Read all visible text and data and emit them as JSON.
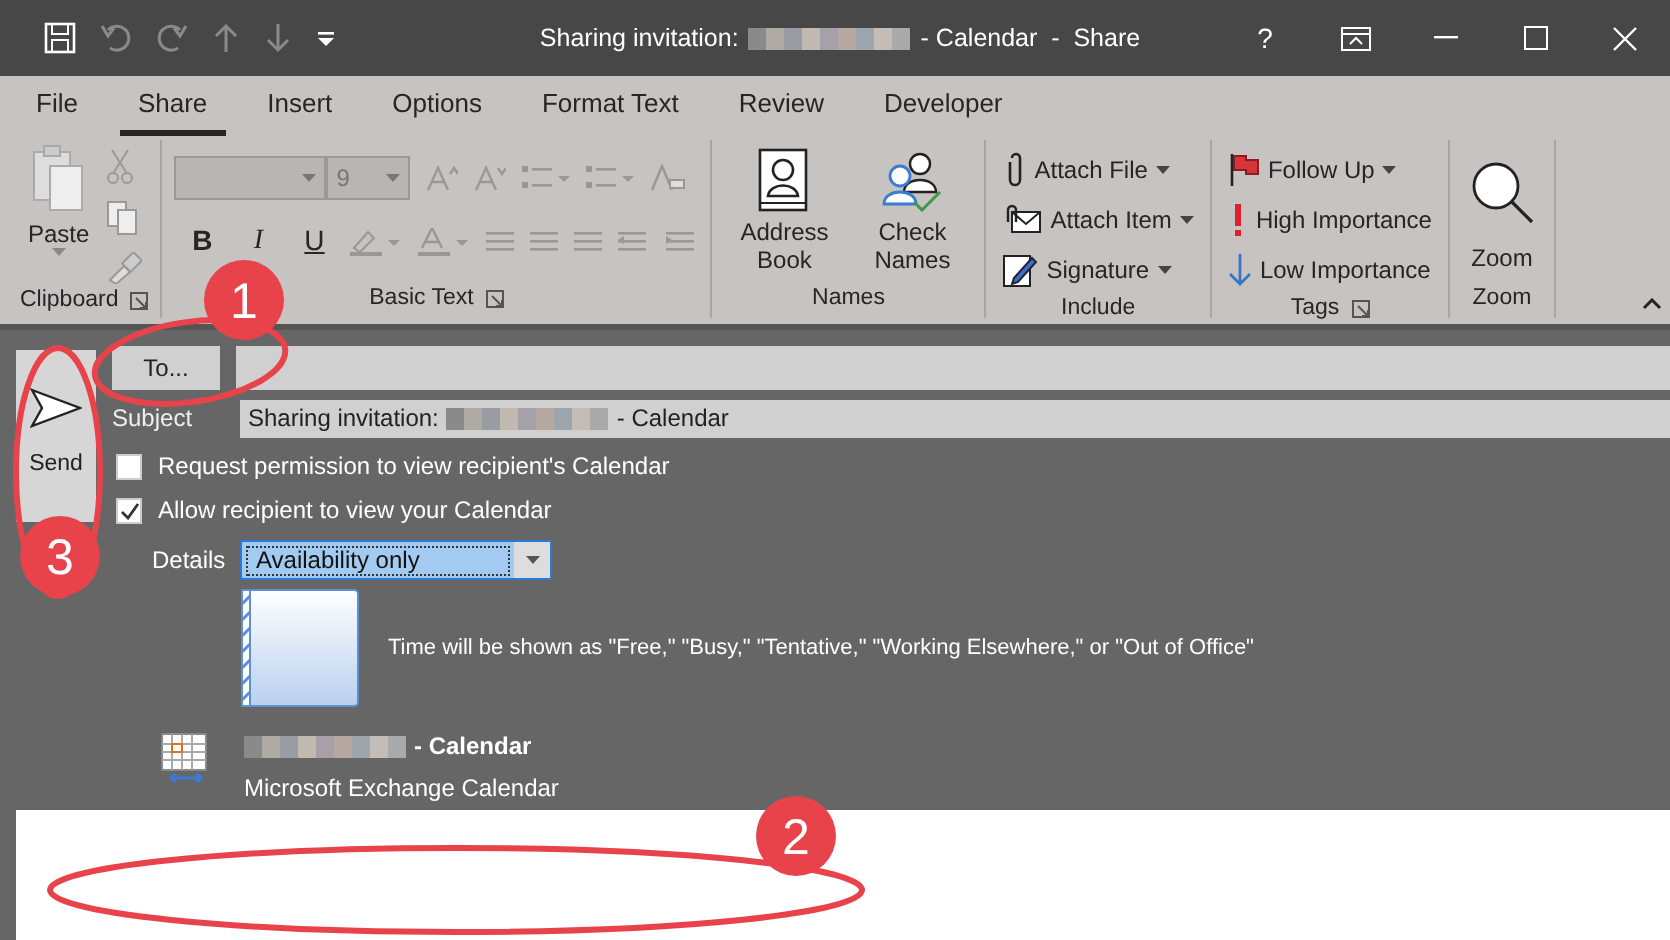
{
  "window": {
    "title_start": "Sharing invitation:",
    "title_end": "- Calendar  -  Share",
    "help": "?"
  },
  "ribbon_tabs": [
    {
      "label": "File",
      "selected": false
    },
    {
      "label": "Share",
      "selected": true
    },
    {
      "label": "Insert",
      "selected": false
    },
    {
      "label": "Options",
      "selected": false
    },
    {
      "label": "Format Text",
      "selected": false
    },
    {
      "label": "Review",
      "selected": false
    },
    {
      "label": "Developer",
      "selected": false
    }
  ],
  "ribbon_groups": [
    {
      "name": "Clipboard",
      "kind": "clipboard",
      "disabled": true,
      "launcher": true,
      "items": [
        {
          "label": "Paste"
        }
      ]
    },
    {
      "name": "Basic Text",
      "kind": "basic-text",
      "disabled": true,
      "launcher": true,
      "font_size": "9",
      "format_buttons": [
        "B",
        "I",
        "U"
      ]
    },
    {
      "name": "Names",
      "kind": "large",
      "disabled": false,
      "launcher": false,
      "items": [
        {
          "label": "Address Book"
        },
        {
          "label": "Check Names"
        }
      ]
    },
    {
      "name": "Include",
      "kind": "list",
      "disabled": false,
      "launcher": false,
      "items": [
        {
          "label": "Attach File",
          "dropdown": true
        },
        {
          "label": "Attach Item",
          "dropdown": true
        },
        {
          "label": "Signature",
          "dropdown": true
        }
      ]
    },
    {
      "name": "Tags",
      "kind": "list",
      "disabled": false,
      "launcher": true,
      "items": [
        {
          "label": "Follow Up",
          "dropdown": true
        },
        {
          "label": "High Importance",
          "dropdown": false
        },
        {
          "label": "Low Importance",
          "dropdown": false
        }
      ]
    },
    {
      "name": "Zoom",
      "kind": "large",
      "disabled": false,
      "launcher": false,
      "items": [
        {
          "label": "Zoom"
        }
      ]
    }
  ],
  "send": {
    "label": "Send"
  },
  "to_button": "To...",
  "subject": {
    "label": "Subject",
    "value_start": "Sharing invitation:",
    "value_end": "- Calendar"
  },
  "options": [
    {
      "label": "Request permission to view recipient's Calendar",
      "checked": false
    },
    {
      "label": "Allow recipient to view your Calendar",
      "checked": true
    }
  ],
  "details": {
    "label": "Details",
    "value": "Availability only"
  },
  "preview_text": "Time will be shown as \"Free,\" \"Busy,\" \"Tentative,\" \"Working Elsewhere,\" or \"Out of Office\"",
  "calendar": {
    "name_end": "- Calendar",
    "type": "Microsoft Exchange Calendar"
  },
  "annotations": [
    {
      "label": "1"
    },
    {
      "label": "2"
    },
    {
      "label": "3"
    }
  ]
}
